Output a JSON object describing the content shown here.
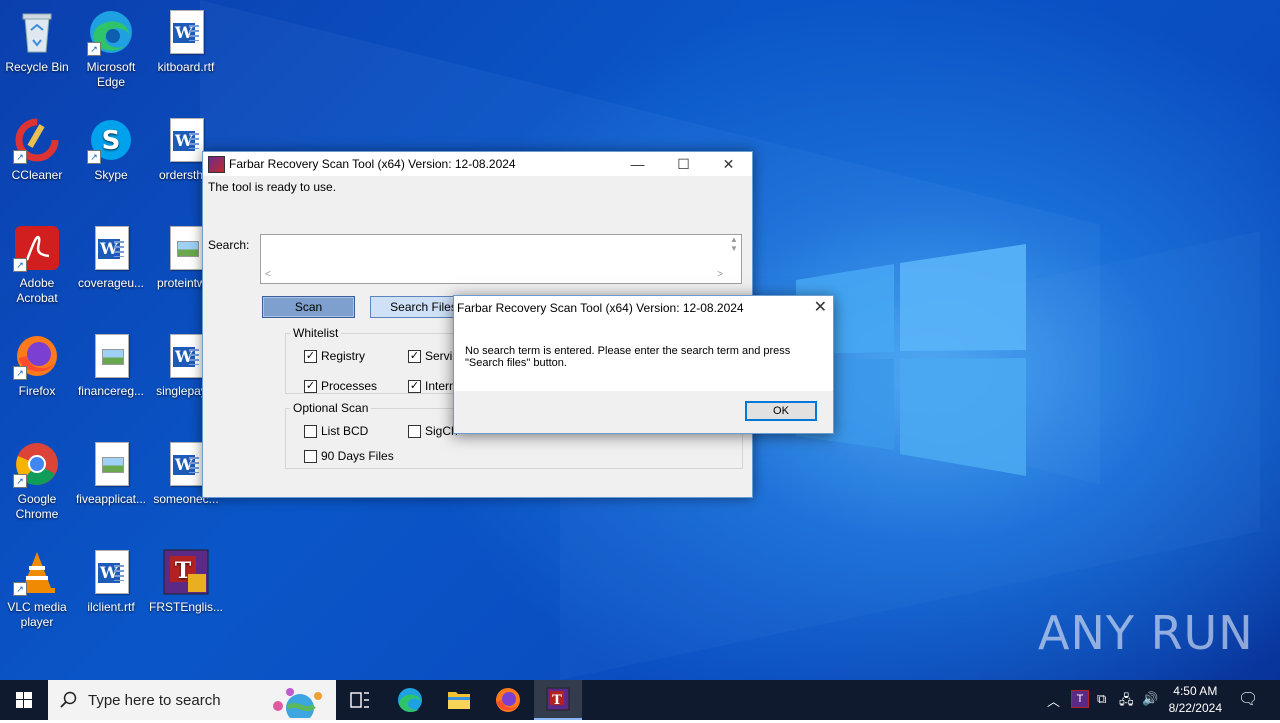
{
  "desktop": {
    "icons": [
      {
        "label": "Recycle Bin"
      },
      {
        "label": "Microsoft Edge"
      },
      {
        "label": "kitboard.rtf"
      },
      {
        "label": "CCleaner"
      },
      {
        "label": "Skype"
      },
      {
        "label": "ordersth..."
      },
      {
        "label": "Adobe Acrobat"
      },
      {
        "label": "coverageu..."
      },
      {
        "label": "proteintw..."
      },
      {
        "label": "Firefox"
      },
      {
        "label": "financereg..."
      },
      {
        "label": "singlepay..."
      },
      {
        "label": "Google Chrome"
      },
      {
        "label": "fiveapplicat..."
      },
      {
        "label": "someonec..."
      },
      {
        "label": "VLC media player"
      },
      {
        "label": "ilclient.rtf"
      },
      {
        "label": "FRSTEnglis..."
      }
    ],
    "watermark": "ANY RUN"
  },
  "frst_window": {
    "title": "Farbar Recovery Scan Tool (x64) Version: 12-08.2024",
    "status": "The tool is ready to use.",
    "search_label": "Search:",
    "search_value": "",
    "scan_button": "Scan",
    "search_files_button": "Search Files",
    "whitelist": {
      "legend": "Whitelist",
      "items": [
        {
          "label": "Registry",
          "checked": true
        },
        {
          "label": "Servic",
          "checked": true
        },
        {
          "label": "Processes",
          "checked": true
        },
        {
          "label": "Intern",
          "checked": true
        }
      ]
    },
    "optional_scan": {
      "legend": "Optional Scan",
      "items": [
        {
          "label": "List BCD",
          "checked": false
        },
        {
          "label": "SigCh",
          "checked": false
        },
        {
          "label": "90 Days Files",
          "checked": false
        }
      ]
    }
  },
  "dialog": {
    "title": "Farbar Recovery Scan Tool (x64) Version: 12-08.2024",
    "message_line1": "No search term is entered. Please enter the search term and press",
    "message_line2": "\"Search files\" button.",
    "ok_button": "OK"
  },
  "taskbar": {
    "search_placeholder": "Type here to search",
    "time": "4:50 AM",
    "date": "8/22/2024"
  }
}
